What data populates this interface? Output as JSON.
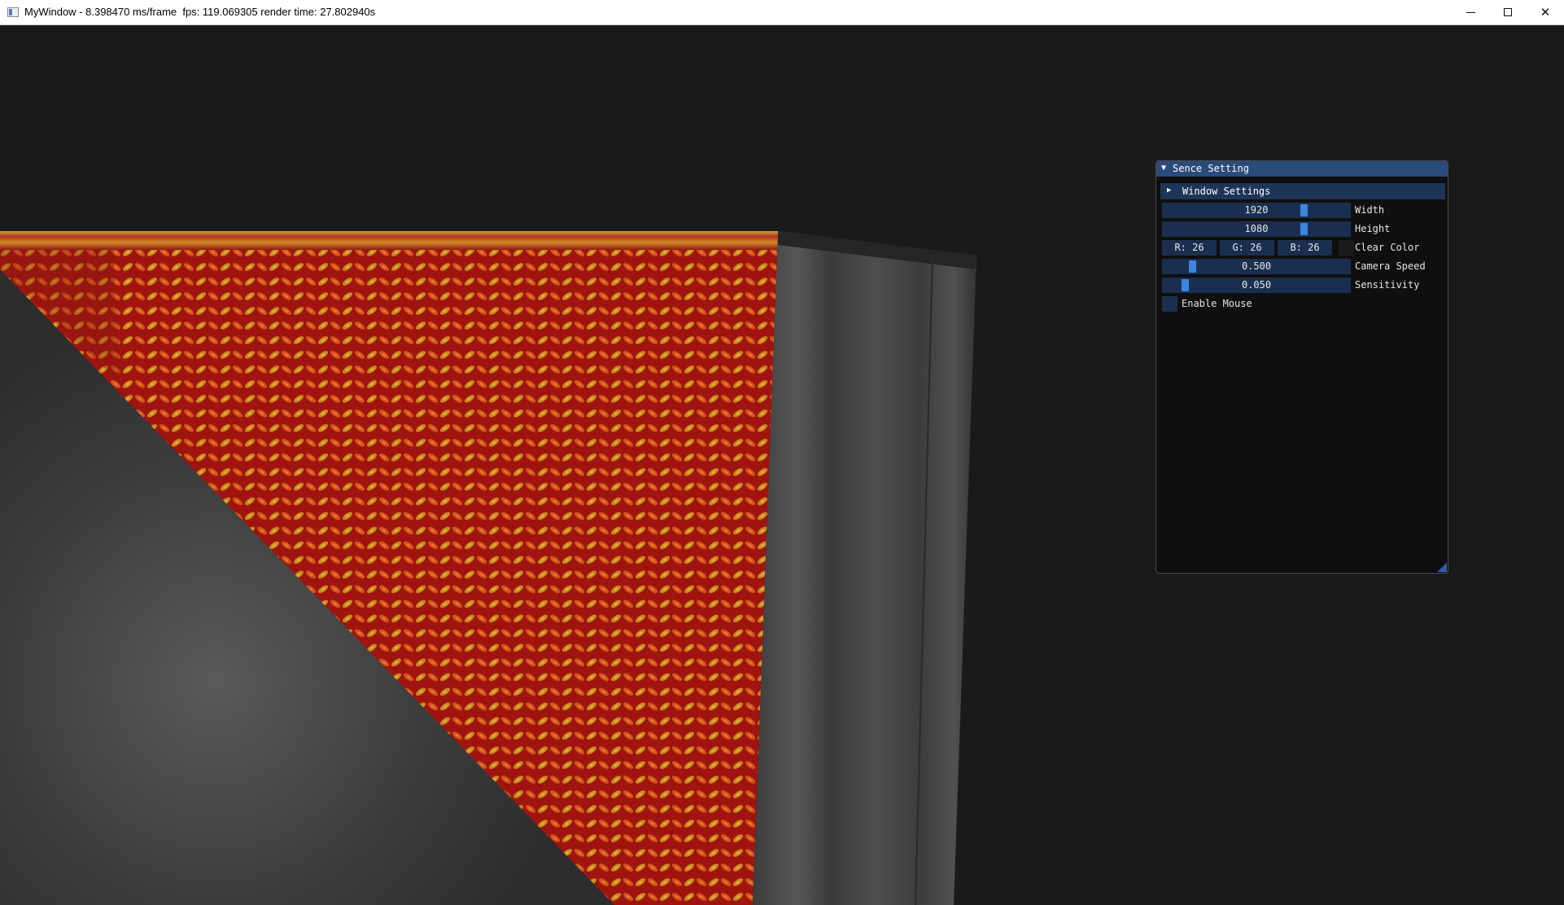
{
  "window": {
    "title": "MyWindow - 8.398470 ms/frame  fps: 119.069305 render time: 27.802940s",
    "minimize_icon": "minimize-icon",
    "maximize_icon": "maximize-icon",
    "close_icon": "close-icon",
    "close_glyph": "✕"
  },
  "viewport": {
    "clear_color": "#1a1a1a"
  },
  "panel": {
    "title": "Sence Setting",
    "title_arrow": "▼",
    "section": {
      "label": "Window Settings",
      "arrow": "▶"
    },
    "width": {
      "value": "1920",
      "label": "Width",
      "fraction": 0.73
    },
    "height": {
      "value": "1080",
      "label": "Height",
      "fraction": 0.73
    },
    "clear_color": {
      "r": "R: 26",
      "g": "G: 26",
      "b": "B: 26",
      "label": "Clear Color",
      "swatch": "#1a1a1a"
    },
    "camera_speed": {
      "value": "0.500",
      "label": "Camera Speed",
      "fraction": 0.13
    },
    "sensitivity": {
      "value": "0.050",
      "label": "Sensitivity",
      "fraction": 0.09
    },
    "enable_mouse": {
      "label": "Enable Mouse",
      "checked": false
    }
  }
}
